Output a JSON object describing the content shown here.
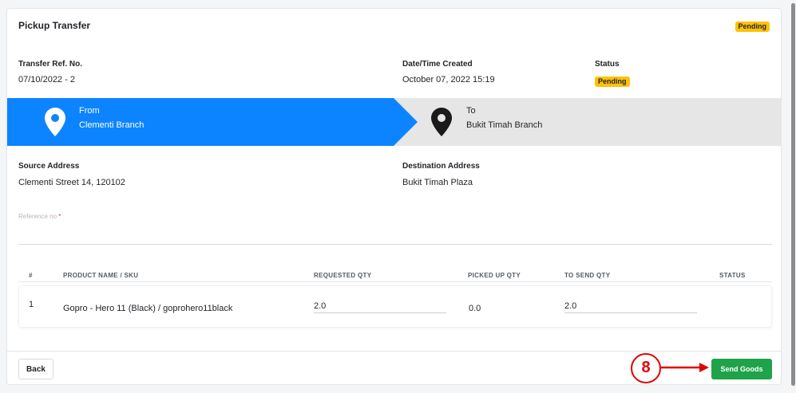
{
  "header": {
    "title": "Pickup Transfer",
    "badge": "Pending"
  },
  "info": {
    "ref_label": "Transfer Ref. No.",
    "ref_value": "07/10/2022 - 2",
    "date_label": "Date/Time Created",
    "date_value": "October 07, 2022 15:19",
    "status_label": "Status",
    "status_value": "Pending"
  },
  "route": {
    "from_label": "From",
    "from_value": "Clementi Branch",
    "to_label": "To",
    "to_value": "Bukit Timah Branch"
  },
  "address": {
    "source_label": "Source Address",
    "source_value": "Clementi Street 14, 120102",
    "dest_label": "Destination Address",
    "dest_value": "Bukit Timah Plaza"
  },
  "reference": {
    "label": "Reference no",
    "required_mark": "*",
    "value": ""
  },
  "table": {
    "headers": [
      "#",
      "PRODUCT NAME / SKU",
      "REQUESTED QTY",
      "PICKED UP QTY",
      "TO SEND QTY",
      "STATUS"
    ],
    "rows": [
      {
        "index": "1",
        "product": "Gopro - Hero 11 (Black) / goprohero11black",
        "requested": "2.0",
        "picked": "0.0",
        "to_send": "2.0",
        "status": ""
      }
    ]
  },
  "footer": {
    "back_label": "Back",
    "send_label": "Send Goods"
  },
  "annotation": {
    "step": "8"
  },
  "colors": {
    "primary": "#0d84ff",
    "success": "#1fa34a",
    "warning": "#ffc107",
    "annotation": "#e00000"
  }
}
